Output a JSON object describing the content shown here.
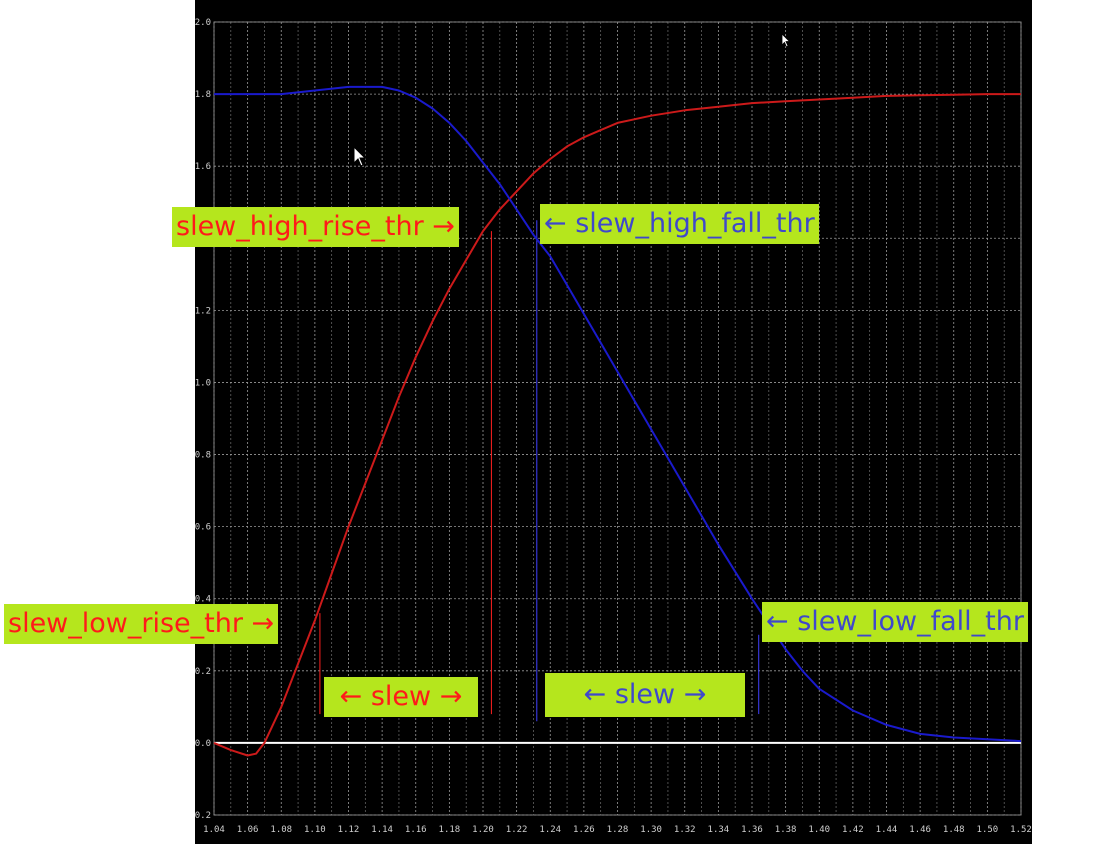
{
  "chart_data": {
    "type": "line",
    "title": "",
    "xlabel": "",
    "ylabel": "",
    "xlim": [
      1.04,
      1.52
    ],
    "ylim": [
      -0.2,
      2.0
    ],
    "grid": true,
    "background": "#000000",
    "x_ticks": [
      "1.04",
      "1.06",
      "1.08",
      "1.10",
      "1.12",
      "1.14",
      "1.16",
      "1.18",
      "1.20",
      "1.22",
      "1.24",
      "1.26",
      "1.28",
      "1.30",
      "1.32",
      "1.34",
      "1.36",
      "1.38",
      "1.40",
      "1.42",
      "1.44",
      "1.46",
      "1.48",
      "1.50",
      "1.52"
    ],
    "y_ticks": [
      "-0.2",
      "0.0",
      "0.2",
      "0.4",
      "0.6",
      "0.8",
      "1.0",
      "1.2",
      "1.4",
      "1.6",
      "1.8",
      "2.0"
    ],
    "series": [
      {
        "color": "#cc1a1a",
        "x": [
          1.04,
          1.05,
          1.06,
          1.065,
          1.07,
          1.08,
          1.09,
          1.1,
          1.11,
          1.12,
          1.13,
          1.14,
          1.15,
          1.16,
          1.17,
          1.18,
          1.19,
          1.2,
          1.21,
          1.22,
          1.23,
          1.24,
          1.25,
          1.26,
          1.27,
          1.28,
          1.29,
          1.3,
          1.32,
          1.34,
          1.36,
          1.38,
          1.4,
          1.42,
          1.44,
          1.46,
          1.48,
          1.5,
          1.52
        ],
        "y": [
          0.0,
          -0.02,
          -0.035,
          -0.03,
          0.0,
          0.1,
          0.22,
          0.34,
          0.47,
          0.6,
          0.72,
          0.84,
          0.96,
          1.07,
          1.17,
          1.26,
          1.34,
          1.42,
          1.48,
          1.53,
          1.58,
          1.62,
          1.655,
          1.68,
          1.7,
          1.72,
          1.73,
          1.74,
          1.755,
          1.765,
          1.775,
          1.78,
          1.785,
          1.79,
          1.795,
          1.797,
          1.798,
          1.8,
          1.8
        ]
      },
      {
        "color": "#1a1acc",
        "x": [
          1.04,
          1.06,
          1.08,
          1.1,
          1.12,
          1.13,
          1.14,
          1.15,
          1.16,
          1.17,
          1.18,
          1.19,
          1.2,
          1.21,
          1.22,
          1.23,
          1.24,
          1.25,
          1.26,
          1.27,
          1.28,
          1.3,
          1.32,
          1.34,
          1.36,
          1.37,
          1.38,
          1.39,
          1.4,
          1.42,
          1.44,
          1.46,
          1.48,
          1.5,
          1.52
        ],
        "y": [
          1.8,
          1.8,
          1.8,
          1.81,
          1.82,
          1.82,
          1.82,
          1.81,
          1.79,
          1.76,
          1.72,
          1.67,
          1.61,
          1.55,
          1.48,
          1.41,
          1.35,
          1.27,
          1.19,
          1.11,
          1.03,
          0.87,
          0.71,
          0.55,
          0.4,
          0.33,
          0.26,
          0.2,
          0.15,
          0.09,
          0.05,
          0.025,
          0.015,
          0.01,
          0.005
        ]
      }
    ],
    "zero_line": {
      "y": 0.0,
      "color": "#ffffff"
    },
    "markers": [
      {
        "x": 1.103,
        "y0": 0.08,
        "y1": 0.36,
        "color": "#ff2020"
      },
      {
        "x": 1.205,
        "y0": 0.08,
        "y1": 1.42,
        "color": "#ff2020"
      },
      {
        "x": 1.232,
        "y0": 0.06,
        "y1": 1.45,
        "color": "#4040ff"
      },
      {
        "x": 1.364,
        "y0": 0.08,
        "y1": 0.3,
        "color": "#4040ff"
      }
    ],
    "annotations": {
      "high_rise": "slew_high_rise_thr →",
      "high_fall": "← slew_high_fall_thr",
      "low_rise": "slew_low_rise_thr →",
      "low_fall": "← slew_low_fall_thr",
      "slew_rise": "← slew →",
      "slew_fall": "← slew →"
    },
    "annotation_colors": {
      "rise": "#ff1a1a",
      "fall": "#3f48cc",
      "box": "#b5e61d"
    }
  }
}
